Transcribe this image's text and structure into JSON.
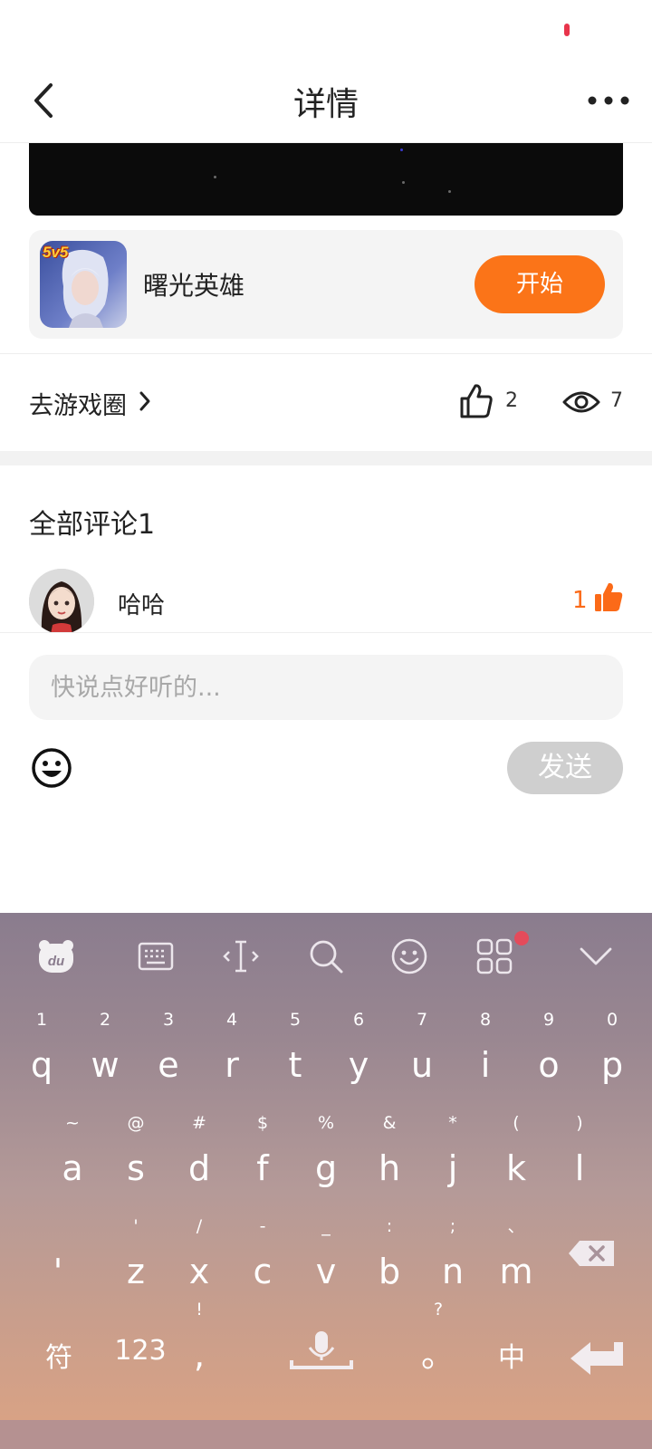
{
  "nav": {
    "title": "详情",
    "back_icon": "chevron-left-icon",
    "more_icon": "more-horizontal-icon"
  },
  "game": {
    "name": "曙光英雄",
    "badge": "5v5",
    "start_label": "开始",
    "accent": "#fb7418"
  },
  "stats": {
    "goto_label": "去游戏圈",
    "likes": "2",
    "views": "7"
  },
  "comments": {
    "title": "全部评论1",
    "items": [
      {
        "user": "哈哈",
        "likes": "1"
      }
    ]
  },
  "composer": {
    "placeholder": "快说点好听的...",
    "send_label": "发送",
    "send_bg": "#cfcfcf"
  },
  "keyboard": {
    "toolbar": [
      "du-logo-icon",
      "keyboard-icon",
      "cursor-move-icon",
      "search-icon",
      "emoji-icon",
      "apps-grid-icon",
      "collapse-chevron-icon"
    ],
    "row1": [
      {
        "k": "q",
        "h": "1"
      },
      {
        "k": "w",
        "h": "2"
      },
      {
        "k": "e",
        "h": "3"
      },
      {
        "k": "r",
        "h": "4"
      },
      {
        "k": "t",
        "h": "5"
      },
      {
        "k": "y",
        "h": "6"
      },
      {
        "k": "u",
        "h": "7"
      },
      {
        "k": "i",
        "h": "8"
      },
      {
        "k": "o",
        "h": "9"
      },
      {
        "k": "p",
        "h": "0"
      }
    ],
    "row2": [
      {
        "k": "a",
        "h": "~"
      },
      {
        "k": "s",
        "h": "@"
      },
      {
        "k": "d",
        "h": "#"
      },
      {
        "k": "f",
        "h": "$"
      },
      {
        "k": "g",
        "h": "%"
      },
      {
        "k": "h",
        "h": "&"
      },
      {
        "k": "j",
        "h": "*"
      },
      {
        "k": "k",
        "h": "("
      },
      {
        "k": "l",
        "h": ")"
      }
    ],
    "row3": [
      {
        "k": "'",
        "h": ""
      },
      {
        "k": "z",
        "h": "'"
      },
      {
        "k": "x",
        "h": "/"
      },
      {
        "k": "c",
        "h": "-"
      },
      {
        "k": "v",
        "h": "_"
      },
      {
        "k": "b",
        "h": ":"
      },
      {
        "k": "n",
        "h": ";"
      },
      {
        "k": "m",
        "h": "、"
      }
    ],
    "bottom": {
      "symbol": "符",
      "numbers": "123",
      "comma": ",",
      "comma_hint": "!",
      "period": "。",
      "period_hint": "?",
      "lang": "中"
    }
  }
}
